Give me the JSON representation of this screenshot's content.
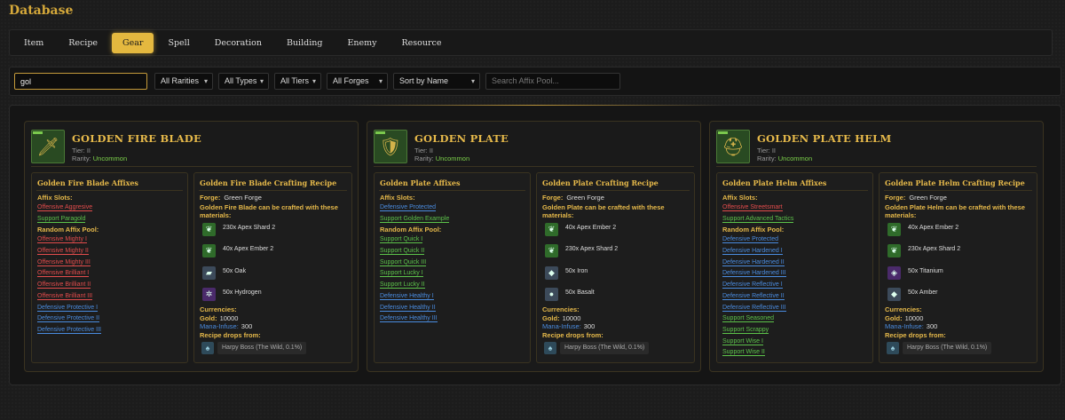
{
  "page_title": "Database",
  "tabs": [
    {
      "label": "Item",
      "active": false
    },
    {
      "label": "Recipe",
      "active": false
    },
    {
      "label": "Gear",
      "active": true
    },
    {
      "label": "Spell",
      "active": false
    },
    {
      "label": "Decoration",
      "active": false
    },
    {
      "label": "Building",
      "active": false
    },
    {
      "label": "Enemy",
      "active": false
    },
    {
      "label": "Resource",
      "active": false
    }
  ],
  "filters": {
    "search_value": "gol",
    "rarity": "All Rarities",
    "type": "All Types",
    "tier": "All Tiers",
    "forge": "All Forges",
    "sort": "Sort by Name",
    "affix_placeholder": "Search Affix Pool..."
  },
  "labels": {
    "tier_prefix": "Tier:",
    "rarity_prefix": "Rarity:",
    "affix_slots": "Affix Slots:",
    "random_pool": "Random Affix Pool:",
    "forge": "Forge:",
    "currencies": "Currencies:",
    "gold": "Gold:",
    "mana": "Mana-Infuse:",
    "drops_from": "Recipe drops from:"
  },
  "colors": {
    "accent": "#e4b83f",
    "offensive": "#e34c4c",
    "support": "#5cc34a",
    "defensive": "#4a8ce0",
    "uncommon": "#7cd14a"
  },
  "cards": [
    {
      "name": "GOLDEN FIRE BLADE",
      "icon": "sword-icon",
      "tier": "II",
      "rarity": "Uncommon",
      "affix_title": "Golden Fire Blade Affixes",
      "slots": [
        {
          "name": "Offensive Aggresive",
          "kind": "off"
        },
        {
          "name": "Support Paragold",
          "kind": "sup"
        }
      ],
      "pool": [
        {
          "name": "Offensive Mighty I",
          "kind": "off"
        },
        {
          "name": "Offensive Mighty II",
          "kind": "off"
        },
        {
          "name": "Offensive Mighty III",
          "kind": "off"
        },
        {
          "name": "Offensive Brilliant I",
          "kind": "off"
        },
        {
          "name": "Offensive Brilliant II",
          "kind": "off"
        },
        {
          "name": "Offensive Brilliant III",
          "kind": "off"
        },
        {
          "name": "Defensive Protective I",
          "kind": "def"
        },
        {
          "name": "Defensive Protective II",
          "kind": "def"
        },
        {
          "name": "Defensive Protective III",
          "kind": "def"
        }
      ],
      "recipe_title": "Golden Fire Blade Crafting Recipe",
      "forge": "Green Forge",
      "craft_text": "Golden Fire Blade can be crafted with these materials:",
      "materials": [
        {
          "name": "230x Apex Shard 2",
          "icon": "leaf-icon",
          "color": "#2f6b2a"
        },
        {
          "name": "40x Apex Ember 2",
          "icon": "leaf-icon",
          "color": "#2f6b2a"
        },
        {
          "name": "50x Oak",
          "icon": "log-icon",
          "color": "#3c4a5a"
        },
        {
          "name": "50x Hydrogen",
          "icon": "atom-icon",
          "color": "#4a2a6a"
        }
      ],
      "gold": "10000",
      "mana": "300",
      "boss": "Harpy Boss (The Wild, 0.1%)"
    },
    {
      "name": "GOLDEN PLATE",
      "icon": "armor-icon",
      "tier": "II",
      "rarity": "Uncommon",
      "affix_title": "Golden Plate Affixes",
      "slots": [
        {
          "name": "Defensive Protected",
          "kind": "def"
        },
        {
          "name": "Support Golden Example",
          "kind": "sup"
        }
      ],
      "pool": [
        {
          "name": "Support Quick I",
          "kind": "sup"
        },
        {
          "name": "Support Quick II",
          "kind": "sup"
        },
        {
          "name": "Support Quick III",
          "kind": "sup"
        },
        {
          "name": "Support Lucky I",
          "kind": "sup"
        },
        {
          "name": "Support Lucky II",
          "kind": "sup"
        },
        {
          "name": "Defensive Healthy I",
          "kind": "def"
        },
        {
          "name": "Defensive Healthy II",
          "kind": "def"
        },
        {
          "name": "Defensive Healthy III",
          "kind": "def"
        }
      ],
      "recipe_title": "Golden Plate Crafting Recipe",
      "forge": "Green Forge",
      "craft_text": "Golden Plate can be crafted with these materials:",
      "materials": [
        {
          "name": "40x Apex Ember 2",
          "icon": "leaf-icon",
          "color": "#2f6b2a"
        },
        {
          "name": "230x Apex Shard 2",
          "icon": "leaf-icon",
          "color": "#2f6b2a"
        },
        {
          "name": "50x Iron",
          "icon": "ore-icon",
          "color": "#3c4a5a"
        },
        {
          "name": "50x Basalt",
          "icon": "rock-icon",
          "color": "#3c4a5a"
        }
      ],
      "gold": "10000",
      "mana": "300",
      "boss": "Harpy Boss (The Wild, 0.1%)"
    },
    {
      "name": "GOLDEN PLATE HELM",
      "icon": "helm-icon",
      "tier": "II",
      "rarity": "Uncommon",
      "affix_title": "Golden Plate Helm Affixes",
      "slots": [
        {
          "name": "Offensive Streetsmart",
          "kind": "off"
        },
        {
          "name": "Support Advanced Tactics",
          "kind": "sup"
        }
      ],
      "pool": [
        {
          "name": "Defensive Protected",
          "kind": "def"
        },
        {
          "name": "Defensive Hardened I",
          "kind": "def"
        },
        {
          "name": "Defensive Hardened II",
          "kind": "def"
        },
        {
          "name": "Defensive Hardened III",
          "kind": "def"
        },
        {
          "name": "Defensive Reflective I",
          "kind": "def"
        },
        {
          "name": "Defensive Reflective II",
          "kind": "def"
        },
        {
          "name": "Defensive Reflective III",
          "kind": "def"
        },
        {
          "name": "Support Seasoned",
          "kind": "sup"
        },
        {
          "name": "Support Scrappy",
          "kind": "sup"
        },
        {
          "name": "Support Wise I",
          "kind": "sup"
        },
        {
          "name": "Support Wise II",
          "kind": "sup"
        }
      ],
      "recipe_title": "Golden Plate Helm Crafting Recipe",
      "forge": "Green Forge",
      "craft_text": "Golden Plate Helm can be crafted with these materials:",
      "materials": [
        {
          "name": "40x Apex Ember 2",
          "icon": "leaf-icon",
          "color": "#2f6b2a"
        },
        {
          "name": "230x Apex Shard 2",
          "icon": "leaf-icon",
          "color": "#2f6b2a"
        },
        {
          "name": "50x Titanium",
          "icon": "crystal-icon",
          "color": "#4a2a6a"
        },
        {
          "name": "50x Amber",
          "icon": "gem-icon",
          "color": "#3c4a5a"
        }
      ],
      "gold": "10000",
      "mana": "300",
      "boss": "Harpy Boss (The Wild, 0.1%)"
    }
  ]
}
